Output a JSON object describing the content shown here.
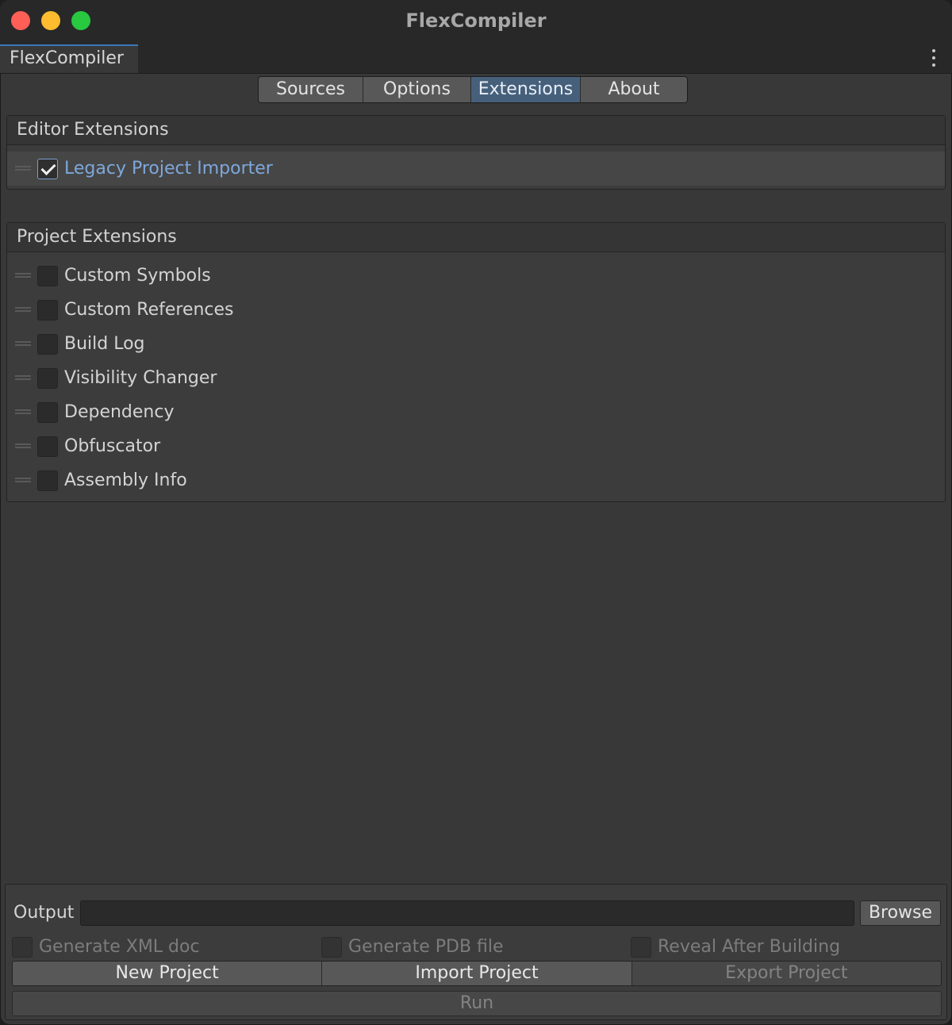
{
  "window": {
    "title": "FlexCompiler"
  },
  "doc_tab": {
    "label": "FlexCompiler"
  },
  "tabs": [
    {
      "label": "Sources",
      "active": false
    },
    {
      "label": "Options",
      "active": false
    },
    {
      "label": "Extensions",
      "active": true
    },
    {
      "label": "About",
      "active": false
    }
  ],
  "editor_extensions": {
    "header": "Editor Extensions",
    "items": [
      {
        "label": "Legacy Project Importer",
        "checked": true
      }
    ]
  },
  "project_extensions": {
    "header": "Project Extensions",
    "items": [
      {
        "label": "Custom Symbols",
        "checked": false
      },
      {
        "label": "Custom References",
        "checked": false
      },
      {
        "label": "Build Log",
        "checked": false
      },
      {
        "label": "Visibility Changer",
        "checked": false
      },
      {
        "label": "Dependency",
        "checked": false
      },
      {
        "label": "Obfuscator",
        "checked": false
      },
      {
        "label": "Assembly Info",
        "checked": false
      }
    ]
  },
  "output": {
    "label": "Output",
    "value": "",
    "browse_label": "Browse"
  },
  "options": [
    {
      "label": "Generate XML doc",
      "checked": false,
      "enabled": false
    },
    {
      "label": "Generate PDB file",
      "checked": false,
      "enabled": false
    },
    {
      "label": "Reveal After Building",
      "checked": false,
      "enabled": false
    }
  ],
  "actions": {
    "new_project": "New Project",
    "import_project": "Import Project",
    "export_project": "Export Project",
    "run": "Run"
  },
  "colors": {
    "window_bg": "#383838",
    "active_tab": "#46607c",
    "link_text": "#7ea8dc",
    "tab_accent": "#3a79bb"
  }
}
